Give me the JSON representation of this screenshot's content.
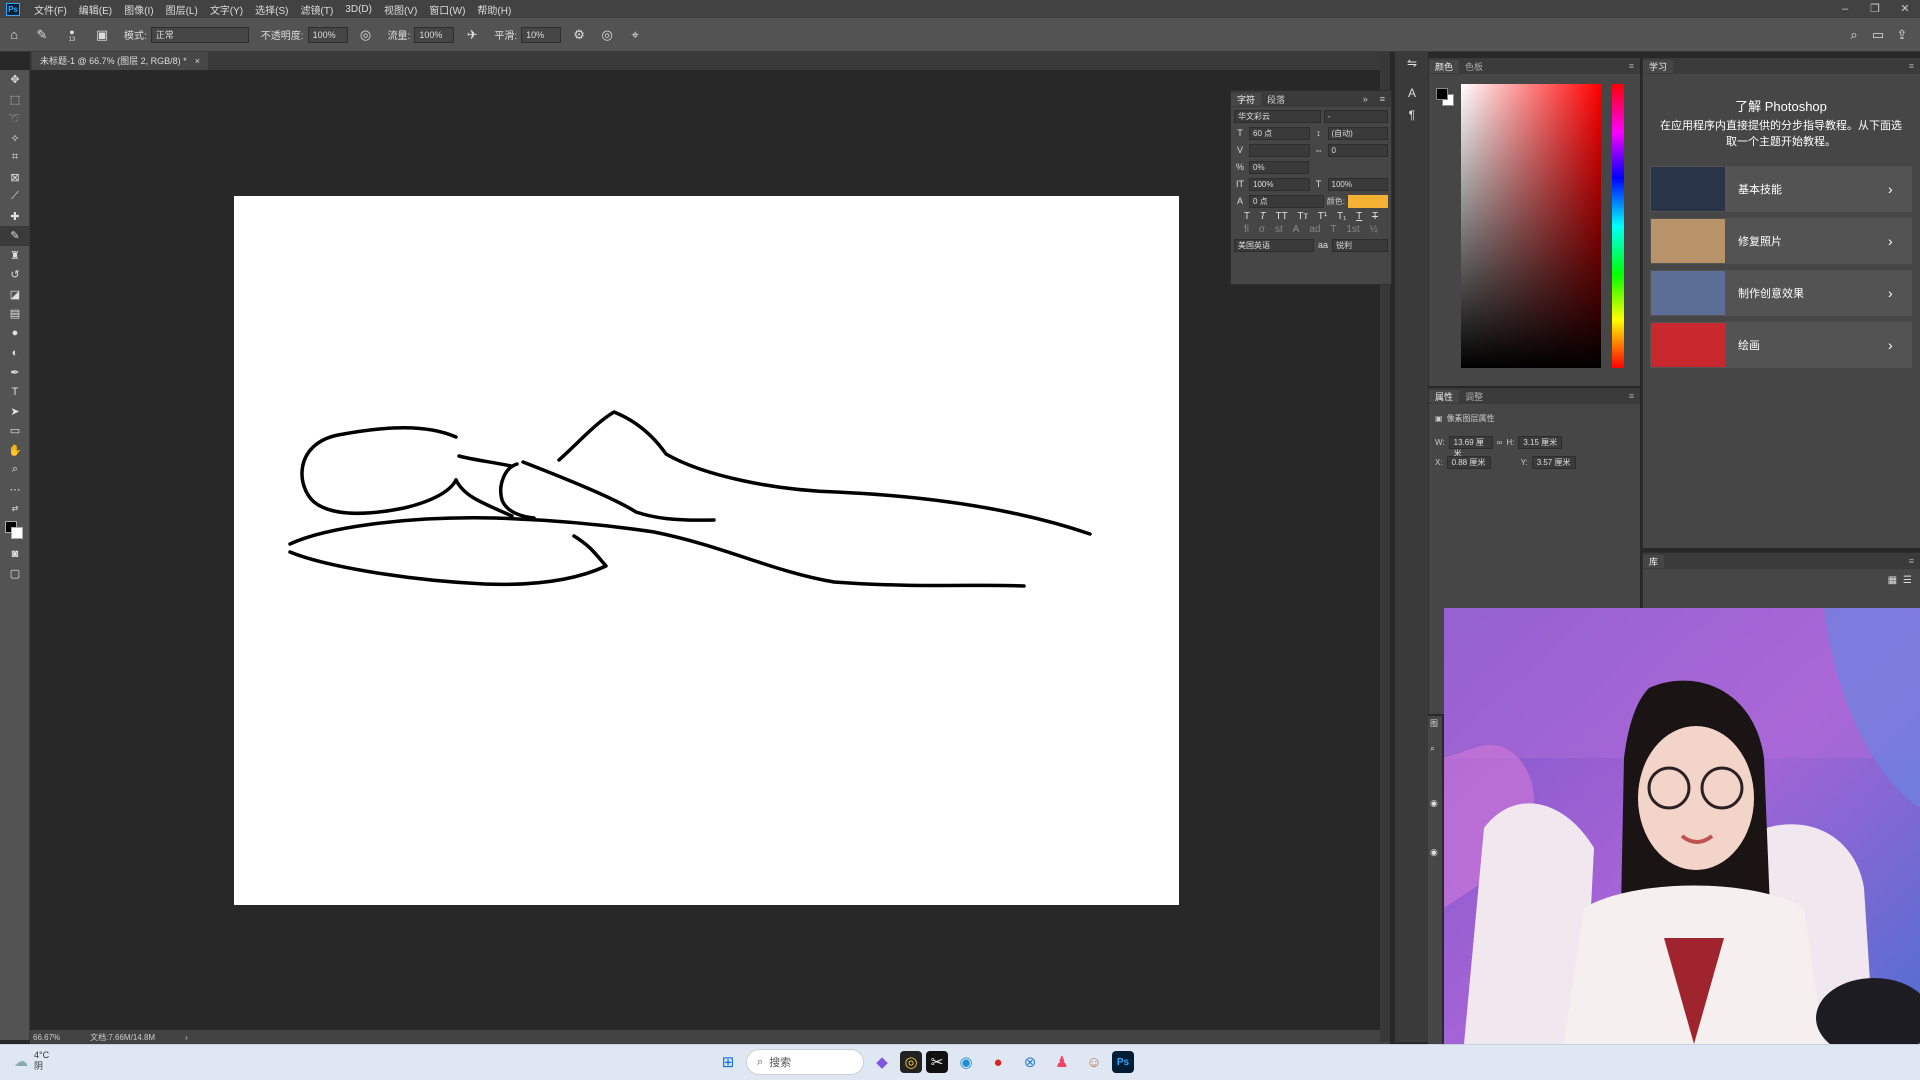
{
  "menubar": {
    "logo": "Ps",
    "items": [
      "文件(F)",
      "编辑(E)",
      "图像(I)",
      "图层(L)",
      "文字(Y)",
      "选择(S)",
      "滤镜(T)",
      "3D(D)",
      "视图(V)",
      "窗口(W)",
      "帮助(H)"
    ]
  },
  "optionsbar": {
    "brush_size": "13",
    "mode_label": "模式:",
    "mode_value": "正常",
    "opacity_label": "不透明度:",
    "opacity_value": "100%",
    "flow_label": "流量:",
    "flow_value": "100%",
    "smoothing_label": "平滑:",
    "smoothing_value": "10%"
  },
  "document": {
    "tab_title": "未标题-1 @ 66.7% (图层 2, RGB/8) *",
    "close": "×",
    "zoom": "66.67%",
    "doc_info": "文档:7.66M/14.8M"
  },
  "character_panel": {
    "tab_character": "字符",
    "tab_paragraph": "段落",
    "font_family": "华文彩云",
    "font_style": "-",
    "font_size": "60 点",
    "leading": "(自动)",
    "kerning": "",
    "tracking": "0",
    "scale_pct": "0%",
    "vscale": "100%",
    "hscale": "100%",
    "baseline": "0 点",
    "color_label": "颜色:",
    "color_value": "#f5b232",
    "language": "美国英语",
    "aa": "锐利"
  },
  "color_panel": {
    "tab_color": "颜色",
    "tab_swatches": "色板"
  },
  "properties_panel": {
    "tab_properties": "属性",
    "tab_adjust": "调整",
    "section": "像素图层属性",
    "w_label": "W:",
    "w_value": "13.69 厘米",
    "h_label": "H:",
    "h_value": "3.15 厘米",
    "x_label": "X:",
    "x_value": "0.88 厘米",
    "y_label": "Y:",
    "y_value": "3.57 厘米"
  },
  "learn_panel": {
    "tab": "学习",
    "title": "了解 Photoshop",
    "subtitle": "在应用程序内直接提供的分步指导教程。从下面选取一个主题开始教程。",
    "cards": [
      {
        "label": "基本技能",
        "thumb": "#2a3448"
      },
      {
        "label": "修复照片",
        "thumb": "#b8936a"
      },
      {
        "label": "制作创意效果",
        "thumb": "#5c6e96"
      },
      {
        "label": "绘画",
        "thumb": "#c8282e"
      }
    ]
  },
  "library_panel": {
    "tab": "库"
  },
  "taskbar": {
    "temperature": "4°C",
    "weather": "阴",
    "search_placeholder": "搜索"
  },
  "icons": {
    "home": "⌂",
    "search": "⌕",
    "brush": "✎",
    "gear": "⚙",
    "chevron": "›"
  }
}
